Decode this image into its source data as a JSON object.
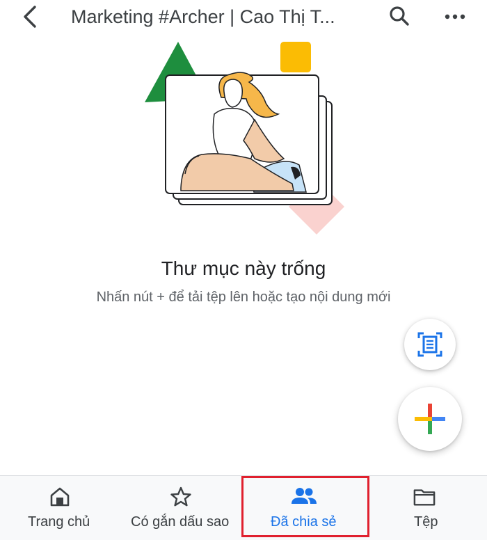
{
  "header": {
    "title": "Marketing #Archer | Cao Thị T..."
  },
  "empty_state": {
    "title": "Thư mục này trống",
    "subtitle": "Nhấn nút + để tải tệp lên hoặc tạo nội dung mới"
  },
  "bottom_nav": {
    "items": [
      {
        "label": "Trang chủ",
        "icon": "home-icon"
      },
      {
        "label": "Có gắn dấu sao",
        "icon": "star-icon"
      },
      {
        "label": "Đã chia sẻ",
        "icon": "shared-people-icon",
        "active": true
      },
      {
        "label": "Tệp",
        "icon": "folder-icon"
      }
    ]
  },
  "colors": {
    "accent": "#1a73e8",
    "highlight_border": "#e0202e",
    "google_blue": "#4285f4",
    "google_red": "#ea4335",
    "google_yellow": "#fbbc04",
    "google_green": "#34a853"
  }
}
